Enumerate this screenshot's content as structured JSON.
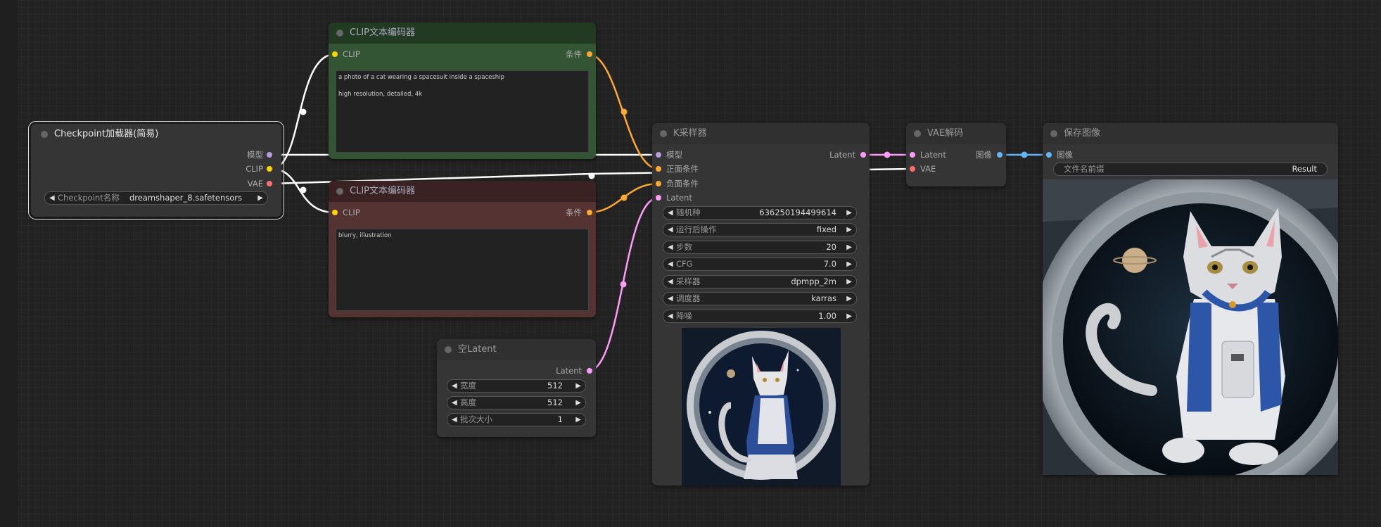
{
  "nodes": {
    "checkpoint": {
      "title": "Checkpoint加载器(简易)",
      "outputs": [
        "模型",
        "CLIP",
        "VAE"
      ],
      "widget_label": "Checkpoint名称",
      "widget_value": "dreamshaper_8.safetensors"
    },
    "clip_pos": {
      "title": "CLIP文本编码器",
      "input": "CLIP",
      "output": "条件",
      "text": "a photo of a cat wearing a spacesuit inside a spaceship\n\nhigh resolution, detailed, 4k"
    },
    "clip_neg": {
      "title": "CLIP文本编码器",
      "input": "CLIP",
      "output": "条件",
      "text": "blurry, illustration"
    },
    "empty_latent": {
      "title": "空Latent",
      "output": "Latent",
      "widgets": [
        {
          "label": "宽度",
          "value": "512"
        },
        {
          "label": "高度",
          "value": "512"
        },
        {
          "label": "批次大小",
          "value": "1"
        }
      ]
    },
    "ksampler": {
      "title": "K采样器",
      "inputs": [
        "模型",
        "正面条件",
        "负面条件",
        "Latent"
      ],
      "output": "Latent",
      "widgets": [
        {
          "label": "随机种",
          "value": "636250194499614"
        },
        {
          "label": "运行后操作",
          "value": "fixed"
        },
        {
          "label": "步数",
          "value": "20"
        },
        {
          "label": "CFG",
          "value": "7.0"
        },
        {
          "label": "采样器",
          "value": "dpmpp_2m"
        },
        {
          "label": "调度器",
          "value": "karras"
        },
        {
          "label": "降噪",
          "value": "1.00"
        }
      ]
    },
    "vae_decode": {
      "title": "VAE解码",
      "inputs": [
        "Latent",
        "VAE"
      ],
      "output": "图像"
    },
    "save_image": {
      "title": "保存图像",
      "input": "图像",
      "widget_label": "文件名前缀",
      "widget_value": "Result"
    }
  },
  "colors": {
    "model": "#b39ddb",
    "clip": "#ffd500",
    "vae": "#ff6e6e",
    "conditioning": "#ffa931",
    "latent": "#ff9cf9",
    "image": "#64b5f6",
    "positive_node": "#335533",
    "negative_node": "#553333"
  },
  "icons": {
    "left_arrow": "◀",
    "right_arrow": "▶"
  }
}
